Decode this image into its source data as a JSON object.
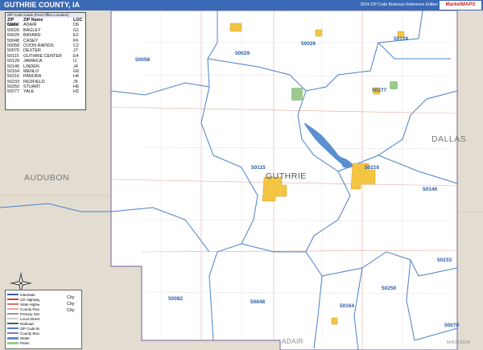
{
  "header": {
    "title": "GUTHRIE COUNTY, IA",
    "edition": "2024 ZIP Code Business Reference Edition",
    "logo_text": "MarketMAPS",
    "bar_color": "#3a69b5"
  },
  "zip_table": {
    "caption": "ZIP Code Guide (Post Office Location)",
    "headers": {
      "zip": "ZIP Code",
      "name": "ZIP Name",
      "loc": "LOC"
    },
    "rows": [
      {
        "zip": "50002",
        "name": "ADAIR",
        "loc": "D6"
      },
      {
        "zip": "50026",
        "name": "BAGLEY",
        "loc": "G1"
      },
      {
        "zip": "50029",
        "name": "BAYARD",
        "loc": "E2"
      },
      {
        "zip": "50048",
        "name": "CASEY",
        "loc": "F6"
      },
      {
        "zip": "50058",
        "name": "COON RAPIDS",
        "loc": "C2"
      },
      {
        "zip": "50070",
        "name": "DEXTER",
        "loc": "J7"
      },
      {
        "zip": "50115",
        "name": "GUTHRIE CENTER",
        "loc": "E4"
      },
      {
        "zip": "50128",
        "name": "JAMAICA",
        "loc": "I1"
      },
      {
        "zip": "50146",
        "name": "LINDEN",
        "loc": "J4"
      },
      {
        "zip": "50164",
        "name": "MENLO",
        "loc": "G6"
      },
      {
        "zip": "50216",
        "name": "PANORA",
        "loc": "H4"
      },
      {
        "zip": "50233",
        "name": "REDFIELD",
        "loc": "J5"
      },
      {
        "zip": "50250",
        "name": "STUART",
        "loc": "H6"
      },
      {
        "zip": "50277",
        "name": "YALE",
        "loc": "H2"
      }
    ]
  },
  "counties": {
    "center": "GUTHRIE",
    "west": "AUDUBON",
    "east": "DALLAS",
    "south": "ADAIR",
    "southeast": "MADISON"
  },
  "zip_labels": {
    "z50058": "50058",
    "z50029": "50029",
    "z50026": "50026",
    "z50128": "50128",
    "z50277": "50277",
    "z50115": "50115",
    "z50216": "50216",
    "z50146": "50146",
    "z50233": "50233",
    "z50082": "50082",
    "z50848": "50848",
    "z50164": "50164",
    "z50250": "50250",
    "z50070": "50070"
  },
  "legend": {
    "rows": [
      "Interstate",
      "US Highway",
      "State Highway",
      "County Road",
      "Primary Streets",
      "Local Streets",
      "Railroad",
      "ZIP Code Boundary",
      "County Boundary",
      "Water",
      "Parks"
    ],
    "city_label_1": "City",
    "city_label_2": "City",
    "city_label_3": "City"
  },
  "colors": {
    "zip_boundary": "#4a80c8",
    "county_boundary": "#8a7aa8",
    "outside_fill": "#e2ddd0",
    "city_fill": "#f4c542",
    "water": "#5b8fd0",
    "park": "#9cc98e",
    "road": "#e8a9a0"
  }
}
